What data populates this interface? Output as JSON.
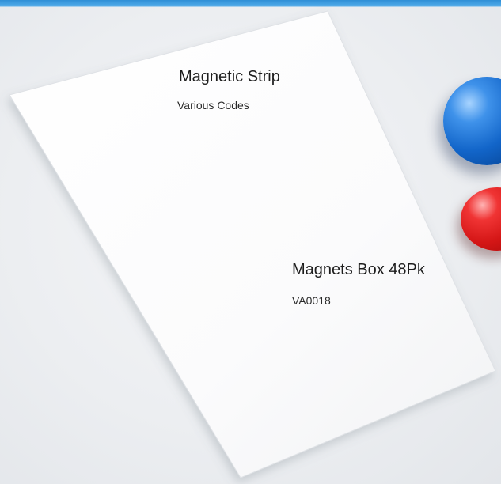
{
  "products": [
    {
      "name": "Magnetic Strip",
      "code": "Various Codes"
    },
    {
      "name": "Magnets Box 48Pk",
      "code": "VA0018"
    }
  ],
  "colors": {
    "top_strip": "#2f8fd6",
    "magnet_blue": "#1265c9",
    "magnet_red": "#d41616",
    "paper": "#ffffff",
    "background": "#eceef1"
  }
}
